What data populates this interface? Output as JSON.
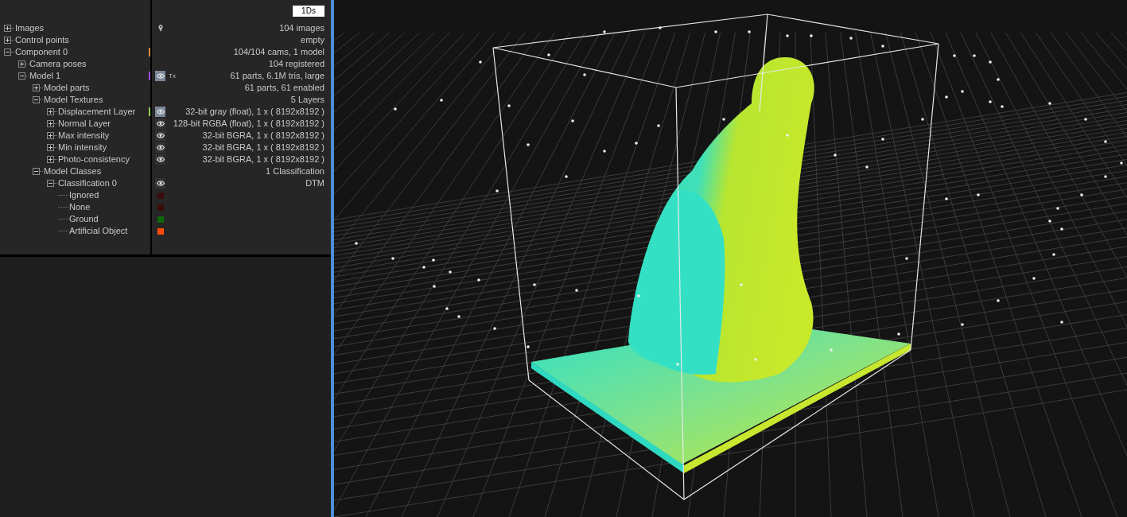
{
  "toolbar": {
    "button": "1Ds"
  },
  "tree": [
    {
      "label": "Images",
      "expanded": false,
      "info": "104 images",
      "kind": "located"
    },
    {
      "label": "Control points",
      "expanded": false,
      "info": "empty"
    },
    {
      "label": "Component 0",
      "expanded": true,
      "info": "104/104 cams, 1 model",
      "color": "#e08848",
      "children": [
        {
          "label": "Camera poses",
          "expanded": false,
          "info": "104 registered"
        },
        {
          "label": "Model 1",
          "expanded": true,
          "info": "61 parts, 6.1M tris, large",
          "color": "#9b4dff",
          "eye": true,
          "selected": true,
          "badge": "Tx",
          "children": [
            {
              "label": "Model parts",
              "expanded": false,
              "info": "61 parts, 61 enabled"
            },
            {
              "label": "Model Textures",
              "expanded": true,
              "info": "5 Layers",
              "children": [
                {
                  "label": "Displacement Layer",
                  "expanded": false,
                  "info": "32-bit gray (float), 1 x ( 8192x8192 )",
                  "color": "#8fd14f",
                  "eye": true,
                  "selected": true
                },
                {
                  "label": "Normal Layer",
                  "expanded": false,
                  "info": "128-bit RGBA (float), 1 x ( 8192x8192 )",
                  "eye": true,
                  "selected": false
                },
                {
                  "label": "Max intensity",
                  "expanded": false,
                  "info": "32-bit BGRA, 1 x ( 8192x8192 )",
                  "eye": true,
                  "selected": false
                },
                {
                  "label": "Min intensity",
                  "expanded": false,
                  "info": "32-bit BGRA, 1 x ( 8192x8192 )",
                  "eye": true,
                  "selected": false
                },
                {
                  "label": "Photo-consistency",
                  "expanded": false,
                  "info": "32-bit BGRA, 1 x ( 8192x8192 )",
                  "eye": true,
                  "selected": false
                }
              ]
            },
            {
              "label": "Model Classes",
              "expanded": true,
              "info": "1 Classification",
              "children": [
                {
                  "label": "Classification 0",
                  "expanded": true,
                  "info": "DTM",
                  "eye": true,
                  "selected": false,
                  "children": [
                    {
                      "label": "Ignored",
                      "color": "#3a0c0c"
                    },
                    {
                      "label": "None",
                      "color": "#3a0c0c"
                    },
                    {
                      "label": "Ground",
                      "color": "#0a6a0a"
                    },
                    {
                      "label": "Artificial Object",
                      "color": "#ff4a0a"
                    }
                  ]
                }
              ]
            }
          ]
        }
      ]
    }
  ]
}
